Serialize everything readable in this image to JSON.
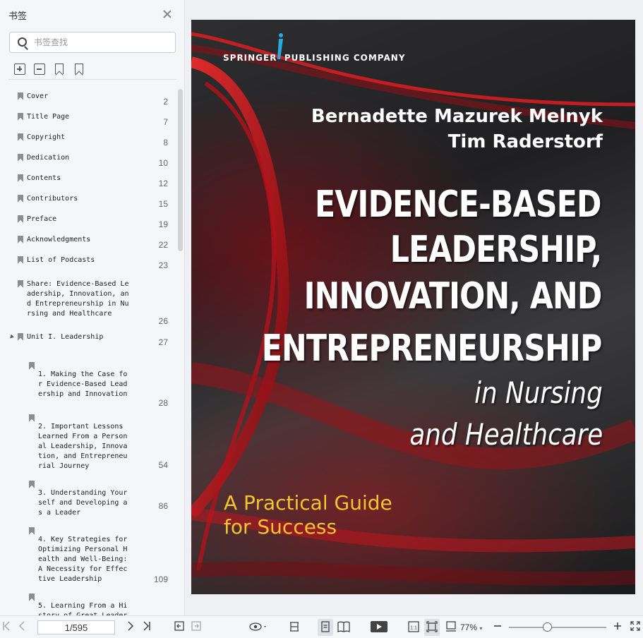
{
  "sidebar": {
    "title": "书签",
    "search_placeholder": "书签查找",
    "bookmarks": [
      {
        "label": "Cover",
        "page": "2"
      },
      {
        "label": "Title Page",
        "page": "7"
      },
      {
        "label": "Copyright",
        "page": "8"
      },
      {
        "label": "Dedication",
        "page": "10"
      },
      {
        "label": "Contents",
        "page": "12"
      },
      {
        "label": "Contributors",
        "page": "15"
      },
      {
        "label": "Preface",
        "page": "19"
      },
      {
        "label": "Acknowledgments",
        "page": "22"
      },
      {
        "label": "List of Podcasts",
        "page": "23"
      },
      {
        "label": "Share: Evidence-Based Le\nadership, Innovation, an\nd Entrepreneurship in Nu\nrsing and Healthcare",
        "page": "26"
      },
      {
        "label": "Unit I. Leadership",
        "page": "27"
      },
      {
        "label": "1. Making the Case fo\nr Evidence-Based Lead\nership and Innovation",
        "page": "28"
      },
      {
        "label": "2. Important Lessons\nLearned From a Person\nal Leadership, Innova\ntion, and Entrepreneu\nrial Journey",
        "page": "54"
      },
      {
        "label": "3. Understanding Your\nself and Developing a\ns a Leader",
        "page": "86"
      },
      {
        "label": "4. Key Strategies for\nOptimizing Personal H\nealth and Well-Being:\nA Necessity for Effec\ntive Leadership",
        "page": "109"
      },
      {
        "label": "5. Learning From a Hi\nstory of Great Leader",
        "page": ""
      }
    ]
  },
  "cover": {
    "publisher_left": "SPRINGER",
    "publisher_right": "PUBLISHING COMPANY",
    "author1": "Bernadette Mazurek Melnyk",
    "author2": "Tim Raderstorf",
    "title_lines": [
      "EVIDENCE-BASED",
      "LEADERSHIP,",
      "INNOVATION, AND",
      "ENTREPRENEURSHIP"
    ],
    "subtitle_lines": [
      "in Nursing",
      "and Healthcare"
    ],
    "tagline_lines": [
      "A Practical Guide",
      "for Success"
    ]
  },
  "toolbar": {
    "page_value": "1/595",
    "zoom": "77%",
    "zoom_fraction": 0.38
  },
  "colors": {
    "tagline": "#f3c531",
    "accent_red": "#c0141c"
  }
}
